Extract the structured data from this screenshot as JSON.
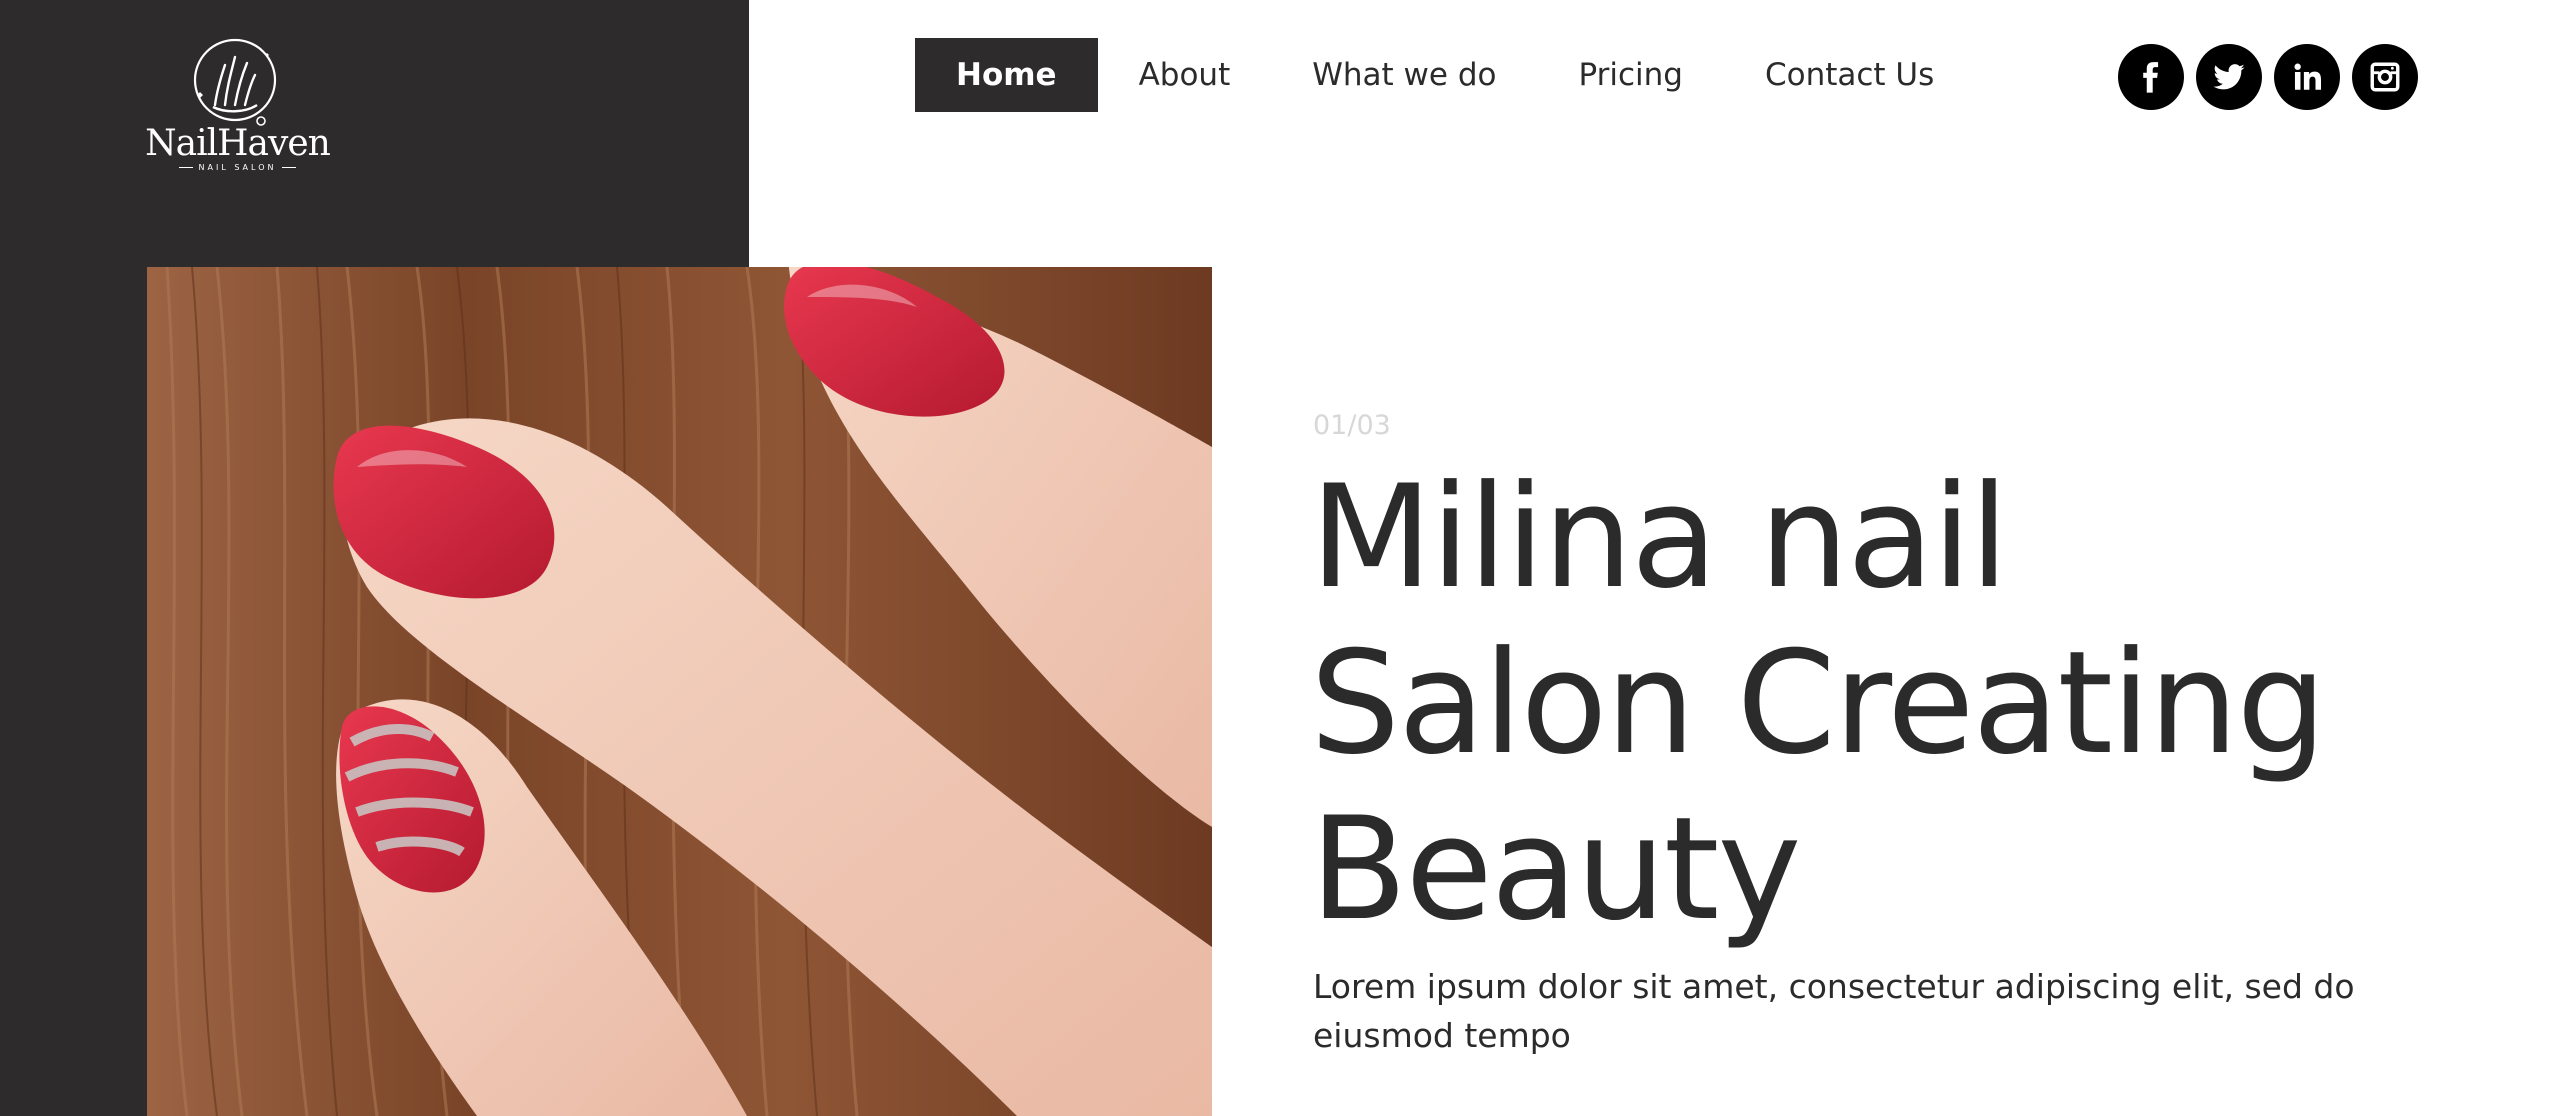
{
  "brand": {
    "name": "NailHaven",
    "tagline": "NAIL SALON"
  },
  "nav": {
    "items": [
      {
        "label": "Home",
        "active": true
      },
      {
        "label": "About",
        "active": false
      },
      {
        "label": "What we do",
        "active": false
      },
      {
        "label": "Pricing",
        "active": false
      },
      {
        "label": "Contact Us",
        "active": false
      }
    ]
  },
  "social": {
    "icons": [
      "facebook-icon",
      "twitter-icon",
      "linkedin-icon",
      "instagram-icon"
    ]
  },
  "hero": {
    "counter": "01/03",
    "headline": [
      "Milina nail",
      "Salon Creating",
      "Beauty"
    ],
    "description": "Lorem ipsum dolor sit amet, consectetur adipiscing elit, sed do eiusmod tempo",
    "image_subject": "hand with red painted nails resting on brown hair"
  },
  "colors": {
    "dark": "#2d2b2c",
    "text": "#2c2b2c",
    "counter": "#d8d6d6",
    "nail_red": "#d8283f"
  }
}
